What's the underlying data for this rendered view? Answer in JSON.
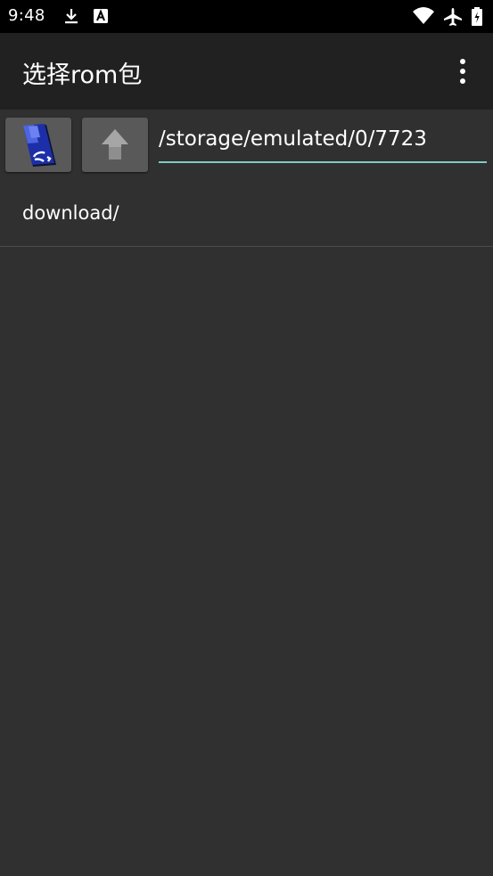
{
  "status_bar": {
    "time": "9:48",
    "icons": [
      "download-icon",
      "a-badge-icon",
      "wifi-icon",
      "airplane-icon",
      "battery-icon"
    ]
  },
  "app_bar": {
    "title": "选择rom包",
    "menu_icon": "more-vert-icon"
  },
  "toolbar": {
    "sdcard_icon": "sd-card-icon",
    "up_icon": "arrow-up-icon",
    "path_value": "/storage/emulated/0/7723",
    "accent_color": "#80cbc4"
  },
  "file_list": {
    "items": [
      {
        "name": "download/"
      }
    ]
  }
}
